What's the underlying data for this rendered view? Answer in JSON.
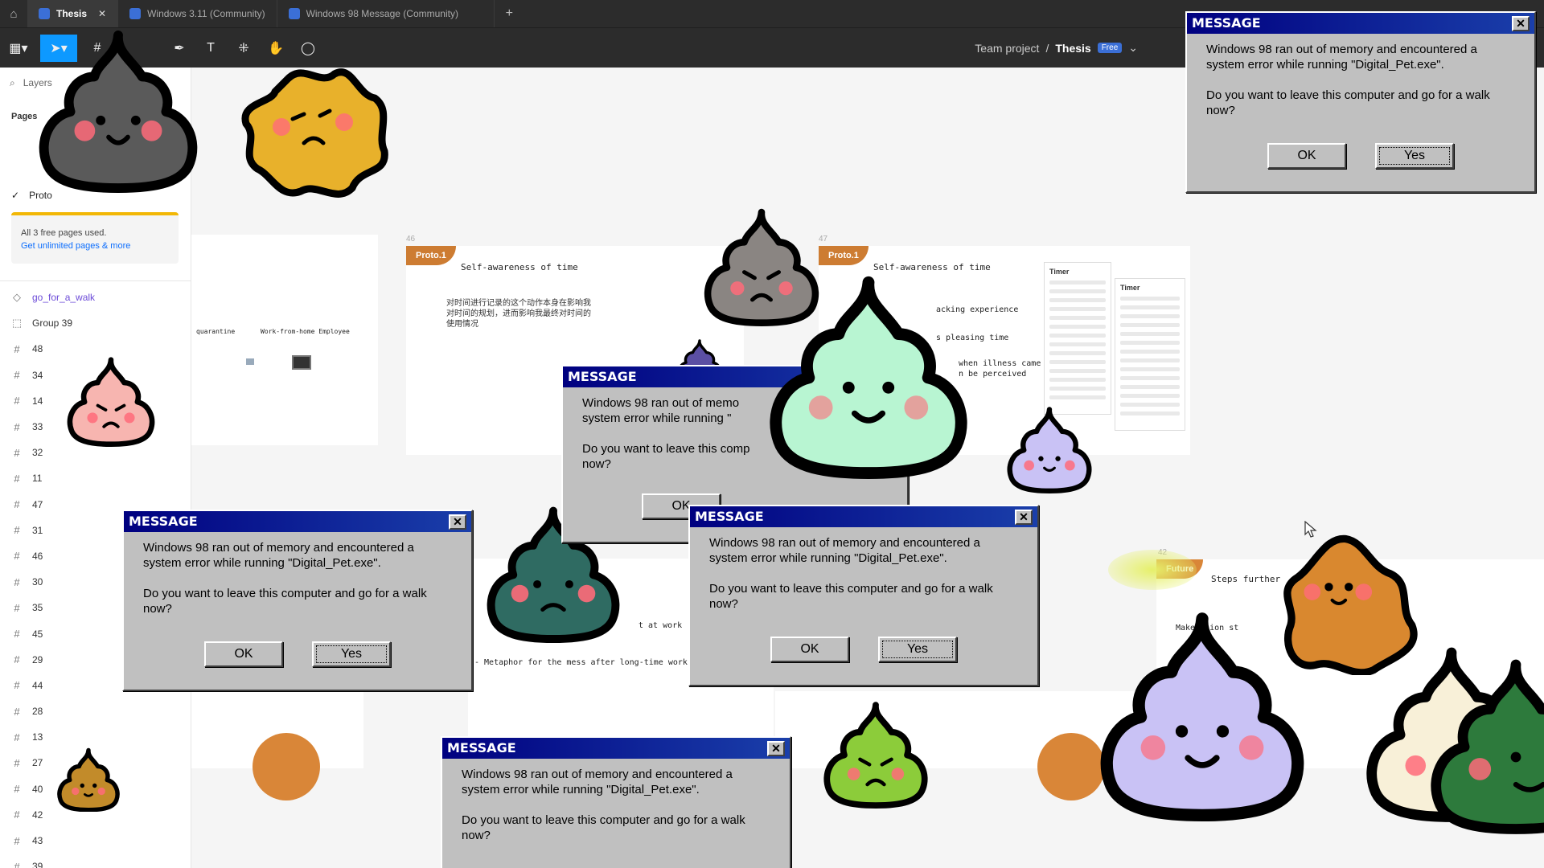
{
  "tabs": [
    {
      "label": "Thesis",
      "active": true
    },
    {
      "label": "Windows 3.11 (Community)",
      "active": false
    },
    {
      "label": "Windows 98 Message (Community)",
      "active": false
    }
  ],
  "toolbar": {
    "team": "Team project",
    "separator": "/",
    "file": "Thesis",
    "plan_badge": "Free"
  },
  "sidebar": {
    "search_placeholder": "Layers",
    "pages_label": "Pages",
    "current_page": "Proto",
    "usage_text": "All 3 free pages used.",
    "usage_link": "Get unlimited pages & more",
    "layers": [
      {
        "icon": "component",
        "label": "go_for_a_walk"
      },
      {
        "icon": "group",
        "label": "Group 39"
      },
      {
        "icon": "frame",
        "label": "48"
      },
      {
        "icon": "frame",
        "label": "34"
      },
      {
        "icon": "frame",
        "label": "14"
      },
      {
        "icon": "frame",
        "label": "33"
      },
      {
        "icon": "frame",
        "label": "32"
      },
      {
        "icon": "frame",
        "label": "11"
      },
      {
        "icon": "frame",
        "label": "47"
      },
      {
        "icon": "frame",
        "label": "31"
      },
      {
        "icon": "frame",
        "label": "46"
      },
      {
        "icon": "frame",
        "label": "30"
      },
      {
        "icon": "frame",
        "label": "35"
      },
      {
        "icon": "frame",
        "label": "45"
      },
      {
        "icon": "frame",
        "label": "29"
      },
      {
        "icon": "frame",
        "label": "44"
      },
      {
        "icon": "frame",
        "label": "28"
      },
      {
        "icon": "frame",
        "label": "13"
      },
      {
        "icon": "frame",
        "label": "27"
      },
      {
        "icon": "frame",
        "label": "40"
      },
      {
        "icon": "frame",
        "label": "42"
      },
      {
        "icon": "frame",
        "label": "43"
      },
      {
        "icon": "frame",
        "label": "39"
      }
    ]
  },
  "canvas": {
    "frame46": {
      "num": "46",
      "tag": "Proto.1",
      "title": "Self-awareness of time",
      "body": "对时间进行记录的这个动作本身在影响我对时间的规划，进而影响我最终对时间的使用情况"
    },
    "frame47": {
      "num": "47",
      "tag": "Proto.1",
      "title": "Self-awareness of time",
      "line1": "acking experience",
      "line2": "s pleasing time",
      "line3": "when illness came",
      "line4": "n be perceived"
    },
    "left_frame": {
      "col1": "quarantine",
      "col2": "Work-from-home Employee"
    },
    "frame42": {
      "num": "42",
      "tag": "Future",
      "title": "Steps further",
      "sub": "Make t    ion st"
    },
    "mid_text": {
      "l1": "t at work",
      "l2": "- Metaphor for the mess after long-time work"
    },
    "phones": {
      "title": "Timer"
    }
  },
  "dialog": {
    "title": "MESSAGE",
    "line1": "Windows 98 ran out of memory and encountered a system error while running  \"Digital_Pet.exe\".",
    "line2": "Do you want to leave this computer and go for a walk now?",
    "ok": "OK",
    "yes": "Yes",
    "close": "✕",
    "partial_line1": "Windows 98 ran out of memo system error while running  \"",
    "partial_line2": "Do you want to leave this comp now?",
    "partial_ok": "OK"
  },
  "pet_colors": {
    "charcoal": "#5a5a5a",
    "yellow": "#e8b12b",
    "gray": "#8a8582",
    "mint": "#b8f5d2",
    "lavender": "#c9c2f5",
    "pink": "#f7b5b0",
    "teal": "#2f6b62",
    "lime": "#8ccc3a",
    "orange": "#d9882f",
    "cream": "#f8f0d8",
    "green": "#2d7a3c",
    "purple": "#5b4fa3"
  }
}
